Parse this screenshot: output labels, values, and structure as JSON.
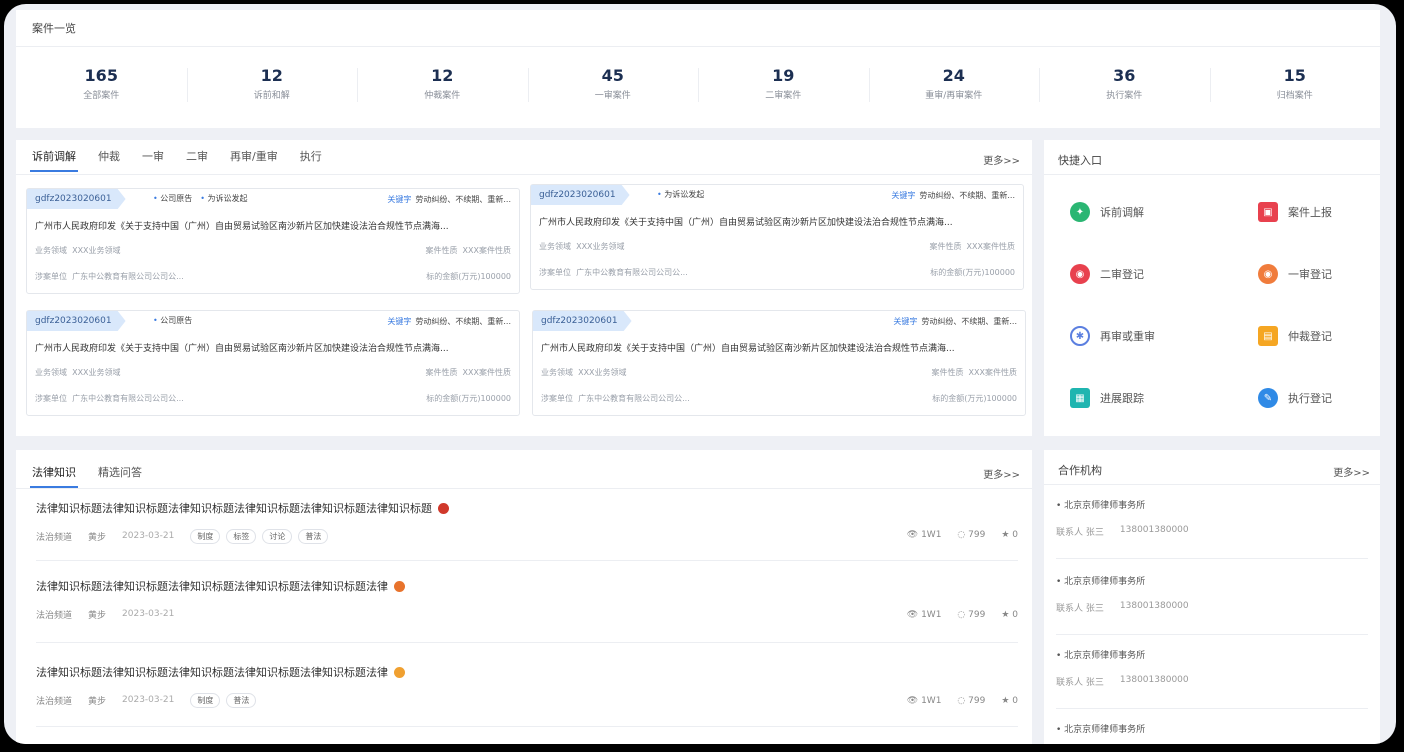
{
  "overview": {
    "title": "案件一览",
    "stats": [
      {
        "value": "165",
        "label": "全部案件"
      },
      {
        "value": "12",
        "label": "诉前和解"
      },
      {
        "value": "12",
        "label": "仲裁案件"
      },
      {
        "value": "45",
        "label": "一审案件"
      },
      {
        "value": "19",
        "label": "二审案件"
      },
      {
        "value": "24",
        "label": "重审/再审案件"
      },
      {
        "value": "36",
        "label": "执行案件"
      },
      {
        "value": "15",
        "label": "归档案件"
      }
    ]
  },
  "cases": {
    "tabs": [
      "诉前调解",
      "仲裁",
      "一审",
      "二审",
      "再审/重审",
      "执行"
    ],
    "active_tab": "诉前调解",
    "more": "更多>>",
    "cards": [
      {
        "id": "gdfz2023020601",
        "tags": [
          "公司原告",
          "为诉讼发起"
        ],
        "kw_label": "关键字",
        "keywords": "劳动纠纷、不续期、重新...",
        "title": "广州市人民政府印发《关于支持中国（广州）自由贸易试验区南沙新片区加快建设法治合规性节点满海...",
        "field_label": "业务领域",
        "field": "XXX业务领域",
        "nature_label": "案件性质",
        "nature": "XXX案件性质",
        "party_label": "涉案单位",
        "party": "广东中公教育有限公司公司公...",
        "amount_label": "标的金额(万元)",
        "amount": "100000"
      },
      {
        "id": "gdfz2023020601",
        "tags": [
          "为诉讼发起"
        ],
        "kw_label": "关键字",
        "keywords": "劳动纠纷、不续期、重新...",
        "title": "广州市人民政府印发《关于支持中国（广州）自由贸易试验区南沙新片区加快建设法治合规性节点满海...",
        "field_label": "业务领域",
        "field": "XXX业务领域",
        "nature_label": "案件性质",
        "nature": "XXX案件性质",
        "party_label": "涉案单位",
        "party": "广东中公教育有限公司公司公...",
        "amount_label": "标的金额(万元)",
        "amount": "100000"
      },
      {
        "id": "gdfz2023020601",
        "tags": [
          "公司原告"
        ],
        "kw_label": "关键字",
        "keywords": "劳动纠纷、不续期、重新...",
        "title": "广州市人民政府印发《关于支持中国（广州）自由贸易试验区南沙新片区加快建设法治合规性节点满海...",
        "field_label": "业务领域",
        "field": "XXX业务领域",
        "nature_label": "案件性质",
        "nature": "XXX案件性质",
        "party_label": "涉案单位",
        "party": "广东中公教育有限公司公司公...",
        "amount_label": "标的金额(万元)",
        "amount": "100000"
      },
      {
        "id": "gdfz2023020601",
        "tags": [],
        "kw_label": "关键字",
        "keywords": "劳动纠纷、不续期、重新...",
        "title": "广州市人民政府印发《关于支持中国（广州）自由贸易试验区南沙新片区加快建设法治合规性节点满海...",
        "field_label": "业务领域",
        "field": "XXX业务领域",
        "nature_label": "案件性质",
        "nature": "XXX案件性质",
        "party_label": "涉案单位",
        "party": "广东中公教育有限公司公司公...",
        "amount_label": "标的金额(万元)",
        "amount": "100000"
      }
    ]
  },
  "quick": {
    "title": "快捷入口",
    "items": [
      {
        "label": "诉前调解",
        "icon": "handshake-icon",
        "color": "#2bb673",
        "glyph": "✦"
      },
      {
        "label": "案件上报",
        "icon": "report-icon",
        "color": "#e8414e",
        "glyph": "▣"
      },
      {
        "label": "二审登记",
        "icon": "second-trial-icon",
        "color": "#e8414e",
        "glyph": "◉"
      },
      {
        "label": "一审登记",
        "icon": "first-trial-icon",
        "color": "#f07c3c",
        "glyph": "◉"
      },
      {
        "label": "再审或重审",
        "icon": "retrial-icon",
        "color": "#5b7fe0",
        "glyph": "✱"
      },
      {
        "label": "仲裁登记",
        "icon": "arbitration-icon",
        "color": "#f5a623",
        "glyph": "▤"
      },
      {
        "label": "进展跟踪",
        "icon": "progress-icon",
        "color": "#1fb5b0",
        "glyph": "▦"
      },
      {
        "label": "执行登记",
        "icon": "execute-icon",
        "color": "#2f8ae6",
        "glyph": "✎"
      }
    ]
  },
  "legal": {
    "tabs": [
      "法律知识",
      "精选问答"
    ],
    "active_tab": "法律知识",
    "more": "更多>>",
    "articles": [
      {
        "title": "法律知识标题法律知识标题法律知识标题法律知识标题法律知识标题法律知识标题",
        "hot_color": "#d0382b",
        "source": "法治频道",
        "author": "黄步",
        "date": "2023-03-21",
        "chips": [
          "制度",
          "标签",
          "讨论",
          "普法"
        ],
        "views": "1W1",
        "comments": "799",
        "stars": "0"
      },
      {
        "title": "法律知识标题法律知识标题法律知识标题法律知识标题法律知识标题法律",
        "hot_color": "#e8732c",
        "source": "法治频道",
        "author": "黄步",
        "date": "2023-03-21",
        "chips": [],
        "views": "1W1",
        "comments": "799",
        "stars": "0"
      },
      {
        "title": "法律知识标题法律知识标题法律知识标题法律知识标题法律知识标题法律",
        "hot_color": "#f0a030",
        "source": "法治频道",
        "author": "黄步",
        "date": "2023-03-21",
        "chips": [
          "制度",
          "普法"
        ],
        "views": "1W1",
        "comments": "799",
        "stars": "0"
      }
    ]
  },
  "partners": {
    "title": "合作机构",
    "more": "更多>>",
    "orgs": [
      {
        "name": "北京京师律师事务所",
        "contact_label": "联系人",
        "contact": "张三",
        "phone": "138001380000"
      },
      {
        "name": "北京京师律师事务所",
        "contact_label": "联系人",
        "contact": "张三",
        "phone": "138001380000"
      },
      {
        "name": "北京京师律师事务所",
        "contact_label": "联系人",
        "contact": "张三",
        "phone": "138001380000"
      },
      {
        "name": "北京京师律师事务所",
        "contact_label": "",
        "contact": "",
        "phone": ""
      }
    ]
  }
}
